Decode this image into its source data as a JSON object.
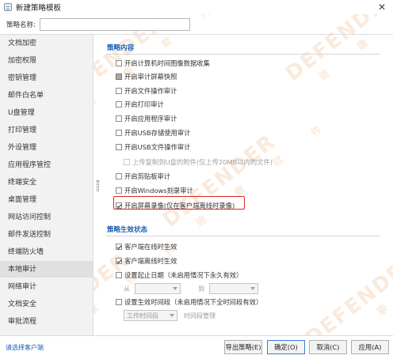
{
  "window": {
    "title": "新建策略模板",
    "close_glyph": "✕"
  },
  "namebar": {
    "label": "策略名称:",
    "value": "",
    "placeholder": ""
  },
  "sidebar": {
    "items": [
      {
        "label": "文档加密",
        "active": false
      },
      {
        "label": "加密权限",
        "active": false
      },
      {
        "label": "密钥管理",
        "active": false
      },
      {
        "label": "邮件白名单",
        "active": false
      },
      {
        "label": "U盘管理",
        "active": false
      },
      {
        "label": "打印管理",
        "active": false
      },
      {
        "label": "外设管理",
        "active": false
      },
      {
        "label": "应用程序管控",
        "active": false
      },
      {
        "label": "终端安全",
        "active": false
      },
      {
        "label": "桌面管理",
        "active": false
      },
      {
        "label": "网站访问控制",
        "active": false
      },
      {
        "label": "邮件发送控制",
        "active": false
      },
      {
        "label": "终端防火墙",
        "active": false
      },
      {
        "label": "本地审计",
        "active": true
      },
      {
        "label": "网络审计",
        "active": false
      },
      {
        "label": "文档安全",
        "active": false
      },
      {
        "label": "审批流程",
        "active": false
      }
    ]
  },
  "policy_content": {
    "title": "策略内容",
    "options": [
      {
        "label": "开启计算机时间图像数据收集",
        "state": "unchecked"
      },
      {
        "label": "开启审计屏幕快照",
        "state": "partial"
      },
      {
        "label": "开启文件操作审计",
        "state": "unchecked"
      },
      {
        "label": "开启打印审计",
        "state": "unchecked"
      },
      {
        "label": "开启应用程序审计",
        "state": "unchecked"
      },
      {
        "label": "开启USB存储使用审计",
        "state": "unchecked"
      },
      {
        "label": "开启USB文件操作审计",
        "state": "unchecked"
      },
      {
        "label": "上传复制到U盘的附件(仅上传20MB以内的文件)",
        "state": "disabled"
      },
      {
        "label": "开启剪贴板审计",
        "state": "unchecked"
      },
      {
        "label": "开启Windows刻录审计",
        "state": "unchecked"
      },
      {
        "label": "开启屏幕录像(仅在客户端离线时录像)",
        "state": "checked"
      }
    ]
  },
  "effective_state": {
    "title": "策略生效状态",
    "online": "客户端在线时生效",
    "offline": "客户端离线时生效",
    "date_range": "设置起止日期（未启用情况下永久有效）",
    "from_label": "从",
    "to_label": "到",
    "time_period": "设置生效时间段（未启用情况下全时间段有效）",
    "worktime_value": "工作时间段",
    "time_mgmt": "时间段管理"
  },
  "watermark": {
    "brand": "DEFENDER",
    "sub": "迪 康 软 件"
  },
  "footer": {
    "link": "请选择客户端",
    "export": "导出策略(E)",
    "ok": "确定(O)",
    "cancel": "取消(C)",
    "apply": "应用(A)"
  }
}
